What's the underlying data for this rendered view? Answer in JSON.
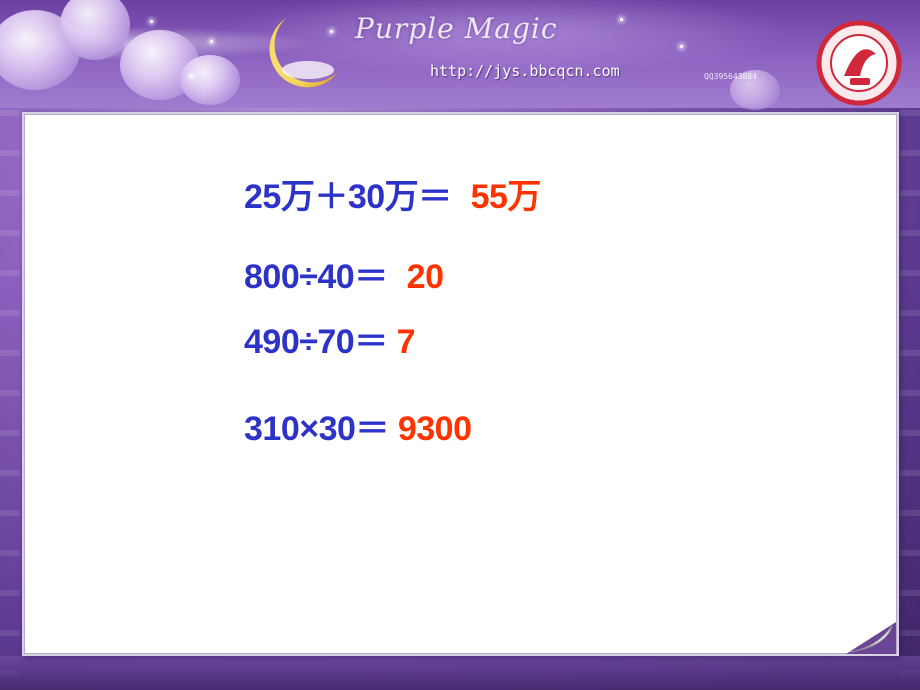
{
  "header": {
    "brand_title": "Purple Magic",
    "url": "http://jys.bbcqcn.com",
    "qq": "QQ395643884"
  },
  "equations": [
    {
      "expression": "25万＋30万＝",
      "answer": "55万"
    },
    {
      "expression": "800÷40＝",
      "answer": "20"
    },
    {
      "expression": "490÷70＝",
      "answer": "7"
    },
    {
      "expression": "310×30＝",
      "answer": "9300"
    }
  ],
  "colors": {
    "expression": "#2e33c7",
    "answer": "#ff3300",
    "background_purple": "#8a5fbd",
    "panel": "#ffffff"
  },
  "icons": {
    "moon": "crescent-moon-icon",
    "logo": "school-badge-icon",
    "page_curl": "page-curl-icon"
  }
}
